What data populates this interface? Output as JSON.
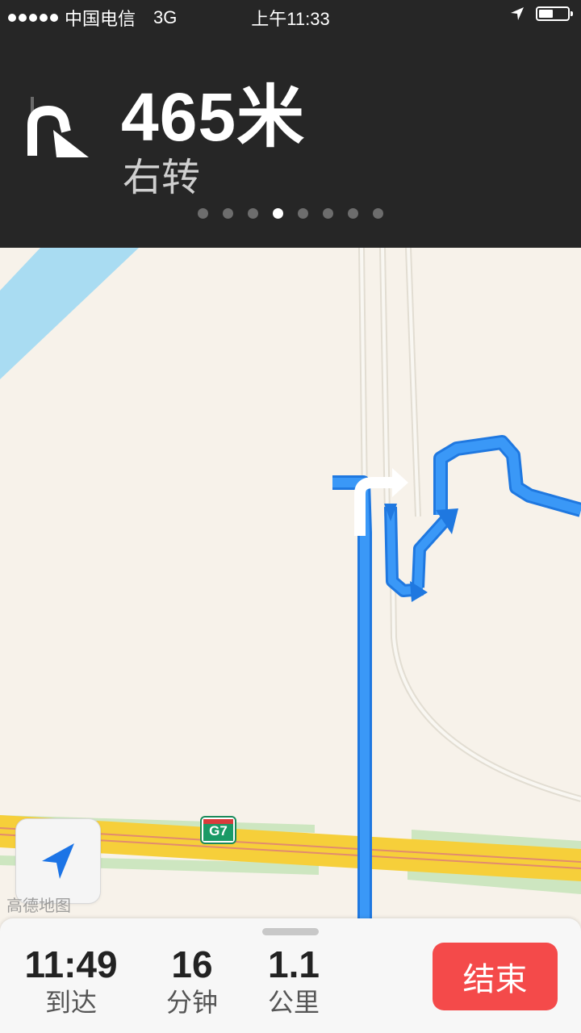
{
  "status_bar": {
    "carrier": "中国电信",
    "network": "3G",
    "time": "上午11:33",
    "battery_level_pct": 50
  },
  "navigation": {
    "distance": "465米",
    "instruction": "右转",
    "turn_icon": "turn-right-arrow-icon",
    "page_count": 8,
    "active_page": 4
  },
  "map": {
    "highway_shield": "G7",
    "watermark": "高德地图",
    "route_color": "#2c8cf5"
  },
  "trip": {
    "arrival_time": "11:49",
    "arrival_label": "到达",
    "duration": "16",
    "duration_label": "分钟",
    "distance": "1.1",
    "distance_label": "公里",
    "end_button": "结束"
  },
  "colors": {
    "header_bg": "#262626",
    "end_button": "#f44a4a",
    "map_bg": "#f7f2ea"
  }
}
